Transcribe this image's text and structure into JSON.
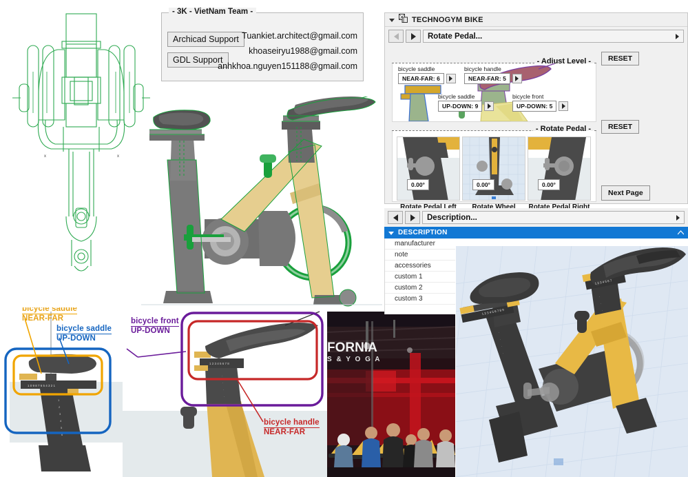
{
  "contact": {
    "title": "- 3K - VietNam Team -",
    "buttons": [
      "Archicad Support",
      "GDL Support"
    ],
    "emails": [
      "Tuankiet.architect@gmail.com",
      "khoaseiryu1988@gmail.com",
      "anhkhoa.nguyen151188@gmail.com"
    ]
  },
  "annotations": {
    "saddle_nearfar": {
      "line1": "bicycle  saddle",
      "line2": "NEAR-FAR",
      "color": "#E8A317"
    },
    "saddle_updown": {
      "line1": "bicycle  saddle",
      "line2": "UP-DOWN",
      "color": "#1565C0"
    },
    "front_updown": {
      "line1": "bicycle  front",
      "line2": "UP-DOWN",
      "color": "#6A1B9A"
    },
    "handle_nearfar": {
      "line1": "bicycle  handle",
      "line2": "NEAR-FAR",
      "color": "#C62828"
    }
  },
  "photo": {
    "sign_line1": "FORNIA",
    "sign_line2": "S  &  Y O G A"
  },
  "object_panel": {
    "header_title": "TECHNOGYM BIKE",
    "header_icon": "object-settings-icon",
    "collapse_icon": "chevron-down-icon",
    "nav": {
      "prev_icon": "triangle-left-icon",
      "next_icon": "triangle-right-icon",
      "prev_enabled": false,
      "next_enabled": true,
      "page_name": "Rotate Pedal...",
      "overflow_icon": "triangle-right-small-icon"
    },
    "adjust_level": {
      "group_label": "- Adjust Level -",
      "reset_label": "RESET",
      "fields": [
        {
          "label": "bicycle saddle",
          "value": "NEAR-FAR: 6"
        },
        {
          "label": "bicycle handle",
          "value": "NEAR-FAR: 5"
        },
        {
          "label": "bicycle saddle",
          "value": "UP-DOWN: 9"
        },
        {
          "label": "bicycle front",
          "value": "UP-DOWN: 5"
        }
      ]
    },
    "rotate_pedal": {
      "group_label": "- Rotate Pedal -",
      "reset_label": "RESET",
      "cells": [
        {
          "caption": "Rotate Pedal Left",
          "value": "0.00°"
        },
        {
          "caption": "Rotate Wheel",
          "value": "0.00°"
        },
        {
          "caption": "Rotate Pedal Right",
          "value": "0.00°"
        }
      ]
    },
    "next_page_label": "Next Page"
  },
  "description_panel": {
    "nav": {
      "prev_icon": "triangle-left-icon",
      "next_icon": "triangle-right-icon",
      "page_name": "Description...",
      "overflow_icon": "triangle-right-small-icon"
    },
    "section_title": "DESCRIPTION",
    "expand_icon": "chevron-down-icon",
    "scroll_icon": "chevron-up-icon",
    "rows": [
      "manufacturer",
      "note",
      "accessories",
      "custom 1",
      "custom 2",
      "custom 3"
    ]
  },
  "colors": {
    "accent_blue": "#1278d4",
    "bike_yellow": "#E8B945",
    "bike_dark": "#4a4a4a",
    "wire_green": "#22a84a"
  }
}
